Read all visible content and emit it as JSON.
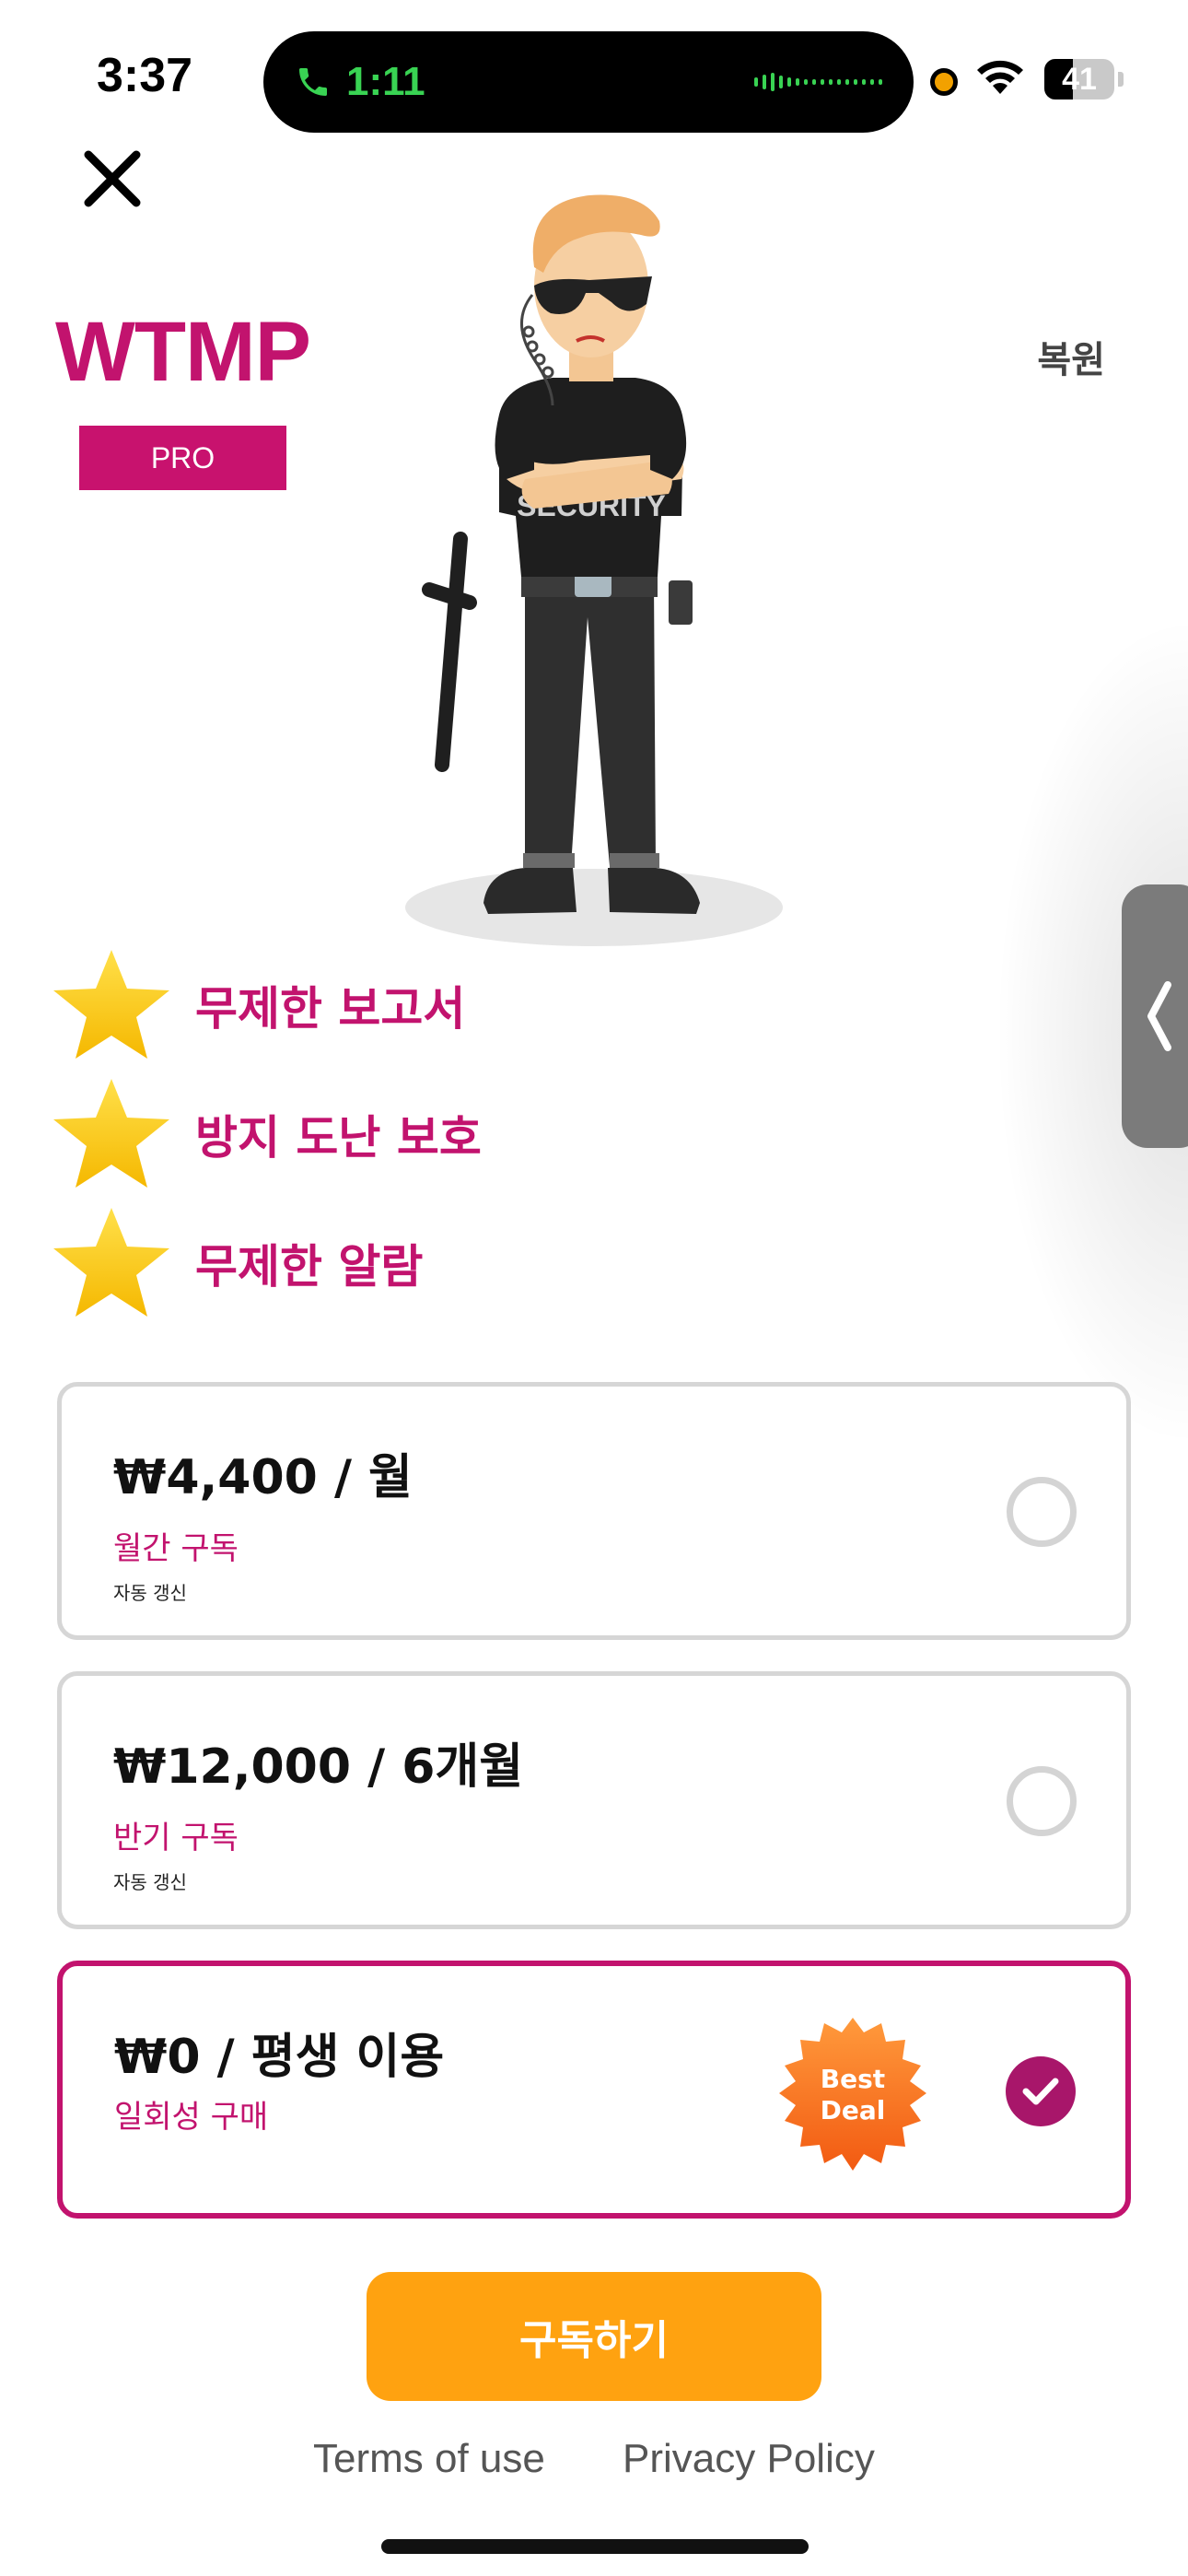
{
  "status_bar": {
    "time": "3:37",
    "call_duration": "1:11",
    "battery": "41",
    "battery_level": 0.41
  },
  "header": {
    "brand": "WTMP",
    "badge": "PRO",
    "restore": "복원",
    "close_icon": "close-icon"
  },
  "features": [
    {
      "label": "무제한 보고서",
      "icon": "star-icon"
    },
    {
      "label": "방지 도난 보호",
      "icon": "star-icon"
    },
    {
      "label": "무제한 알람",
      "icon": "star-icon"
    }
  ],
  "plans": [
    {
      "price": "₩4,400 / 월",
      "subtitle": "월간 구독",
      "note": "자동 갱신",
      "selected": false
    },
    {
      "price": "₩12,000 / 6개월",
      "subtitle": "반기 구독",
      "note": "자동 갱신",
      "selected": false
    },
    {
      "price": "₩0 / 평생 이용",
      "subtitle": "일회성 구매",
      "badge_line1": "Best",
      "badge_line2": "Deal",
      "selected": true
    }
  ],
  "cta": {
    "label": "구독하기"
  },
  "footer": {
    "terms": "Terms of use",
    "privacy": "Privacy Policy"
  },
  "mascot": {
    "shirt_text": "SECURITY"
  },
  "colors": {
    "accent": "#c2136e",
    "cta": "#ffa210",
    "star": "#ffcc00",
    "badge_orange": "#f26b1d"
  }
}
